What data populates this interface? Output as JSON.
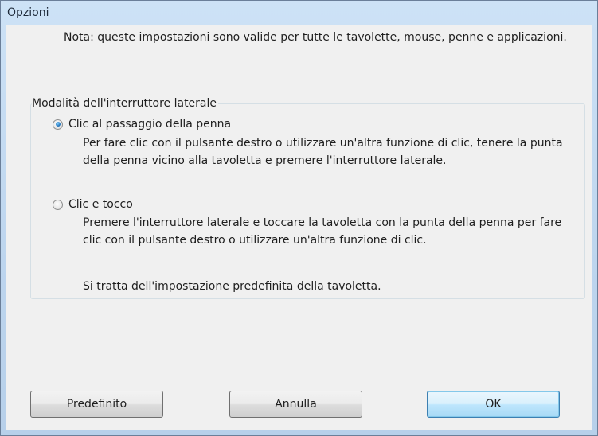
{
  "window": {
    "title": "Opzioni"
  },
  "note": "Nota: queste impostazioni sono valide per tutte le tavolette, mouse, penne e applicazioni.",
  "group": {
    "label": "Modalità dell'interruttore laterale",
    "options": [
      {
        "label": "Clic al passaggio della penna",
        "selected": true,
        "description": "Per fare clic con il pulsante destro o utilizzare un'altra funzione di clic, tenere la punta della penna vicino alla tavoletta e premere l'interruttore laterale."
      },
      {
        "label": "Clic e tocco",
        "selected": false,
        "description": "Premere l'interruttore laterale e toccare la tavoletta con la punta della penna per fare clic con il pulsante destro o utilizzare un'altra funzione di clic.",
        "note": "Si tratta dell'impostazione predefinita della tavoletta."
      }
    ]
  },
  "buttons": {
    "default_label": "Predefinito",
    "cancel_label": "Annulla",
    "ok_label": "OK"
  },
  "colors": {
    "title_bar": "#bdd5ee",
    "client_bg": "#f0f0f0",
    "ok_button_accent": "#3c7fb1"
  }
}
